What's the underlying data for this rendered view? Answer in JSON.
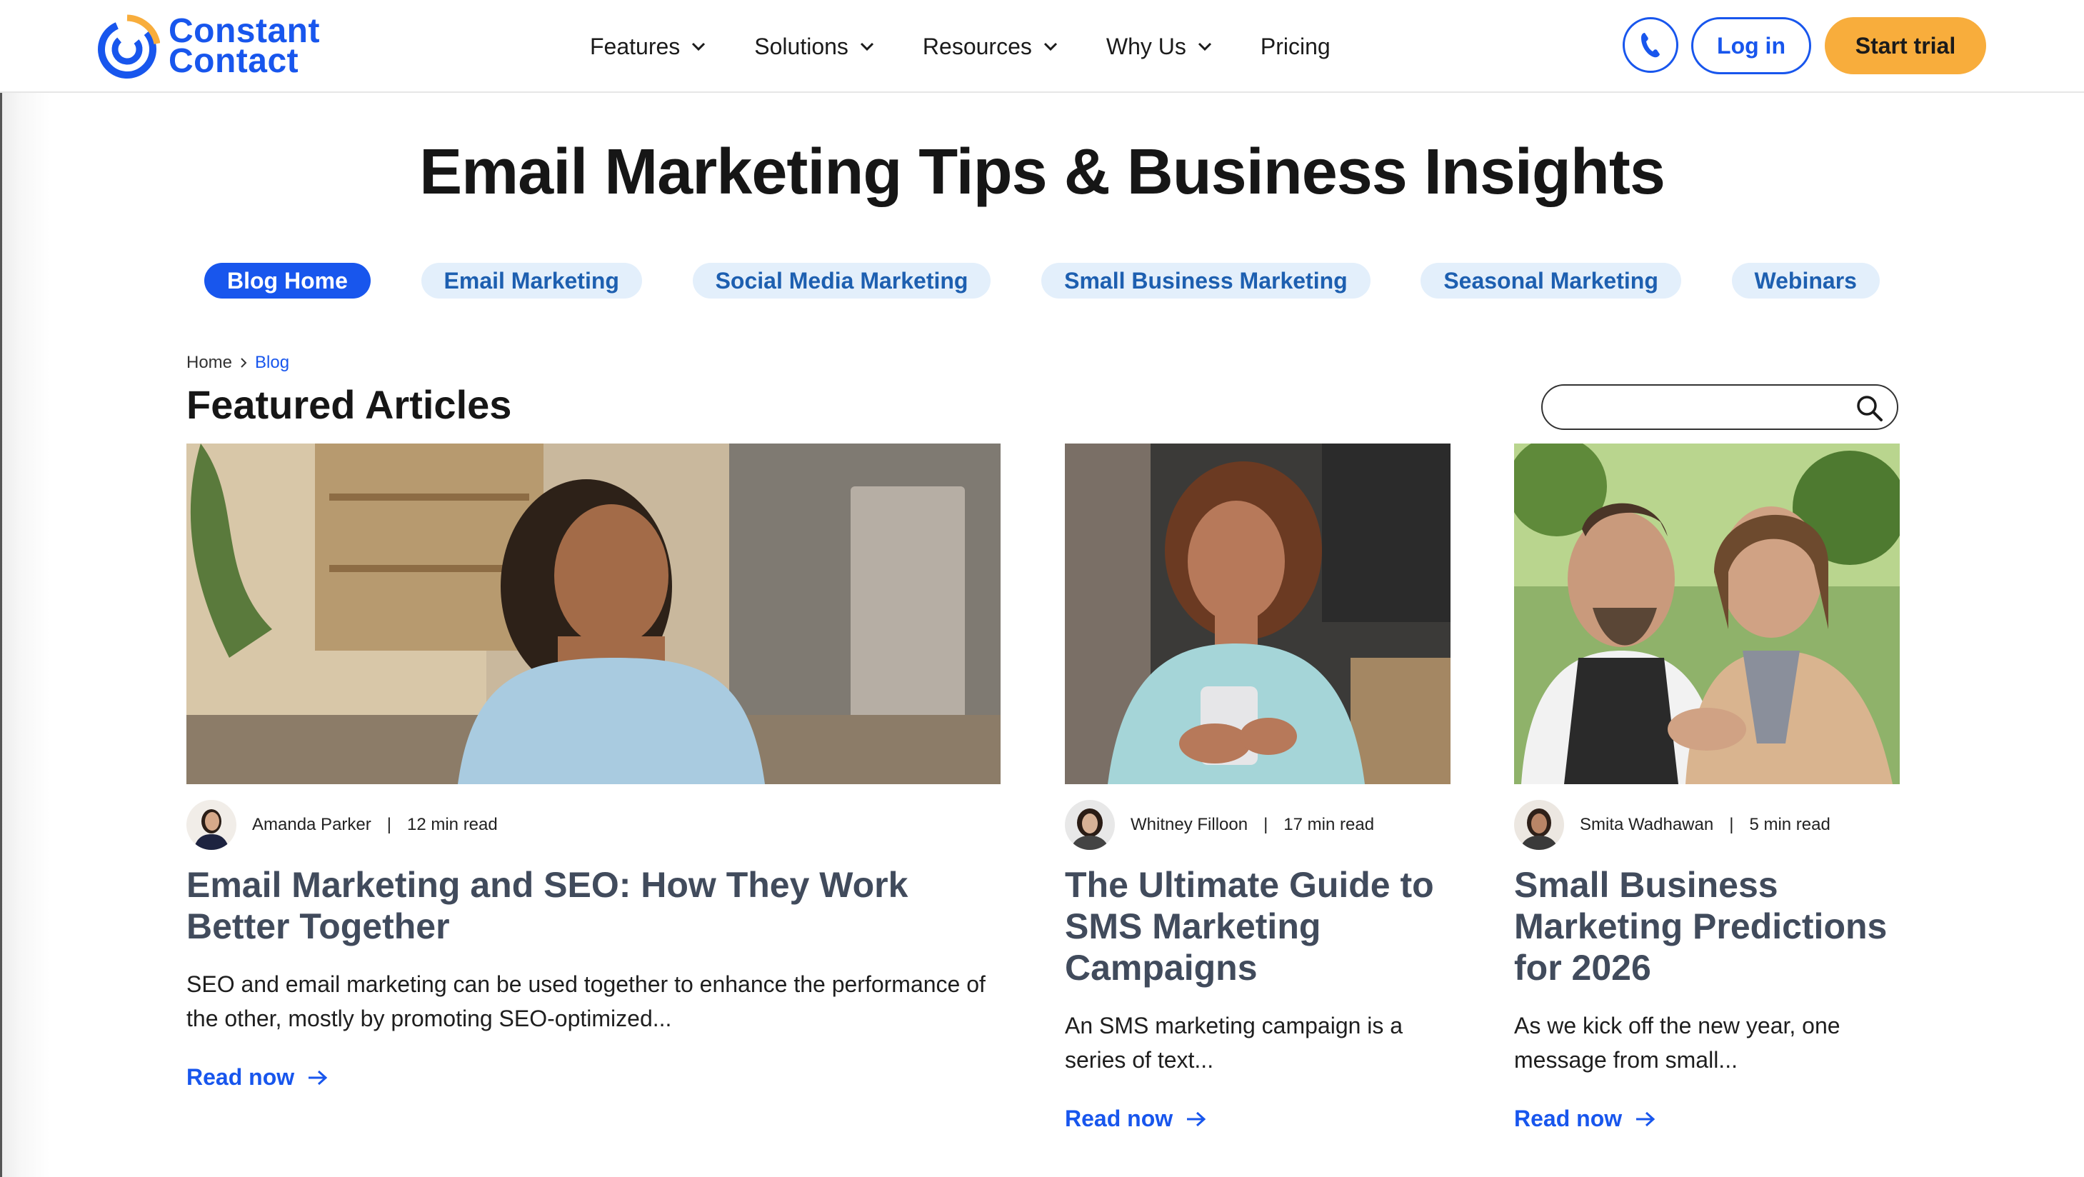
{
  "header": {
    "logo_line1": "Constant",
    "logo_line2": "Contact",
    "nav": [
      {
        "label": "Features",
        "has_dropdown": true
      },
      {
        "label": "Solutions",
        "has_dropdown": true
      },
      {
        "label": "Resources",
        "has_dropdown": true
      },
      {
        "label": "Why Us",
        "has_dropdown": true
      },
      {
        "label": "Pricing",
        "has_dropdown": false
      }
    ],
    "phone_icon": "phone-icon",
    "login_label": "Log in",
    "trial_label": "Start trial"
  },
  "page_title": "Email Marketing Tips & Business Insights",
  "tabs": [
    {
      "label": "Blog Home",
      "active": true
    },
    {
      "label": "Email Marketing",
      "active": false
    },
    {
      "label": "Social Media Marketing",
      "active": false
    },
    {
      "label": "Small Business Marketing",
      "active": false
    },
    {
      "label": "Seasonal Marketing",
      "active": false
    },
    {
      "label": "Webinars",
      "active": false
    }
  ],
  "breadcrumb": {
    "home": "Home",
    "separator": "›",
    "current": "Blog"
  },
  "section_title": "Featured Articles",
  "search": {
    "value": "",
    "placeholder": "",
    "icon": "search-icon"
  },
  "articles": [
    {
      "author": "Amanda Parker",
      "read_time": "12 min read",
      "title": "Email Marketing and SEO: How They Work Better Together",
      "description": "SEO and email marketing can be used together to enhance the performance of the other, mostly by promoting SEO-optimized...",
      "cta": "Read now"
    },
    {
      "author": "Whitney Filloon",
      "read_time": "17 min read",
      "title": "The Ultimate Guide to SMS Marketing Campaigns",
      "description": "An SMS marketing campaign is a series of text...",
      "cta": "Read now"
    },
    {
      "author": "Smita Wadhawan",
      "read_time": "5 min read",
      "title": "Small Business Marketing Predictions for 2026",
      "description": "As we kick off the new year, one message from small...",
      "cta": "Read now"
    }
  ],
  "meta_separator": "|",
  "colors": {
    "brand_blue": "#1856ed",
    "cta_orange": "#f8ad3c",
    "tab_bg": "#e3effb",
    "title_gray": "#414b5c"
  }
}
